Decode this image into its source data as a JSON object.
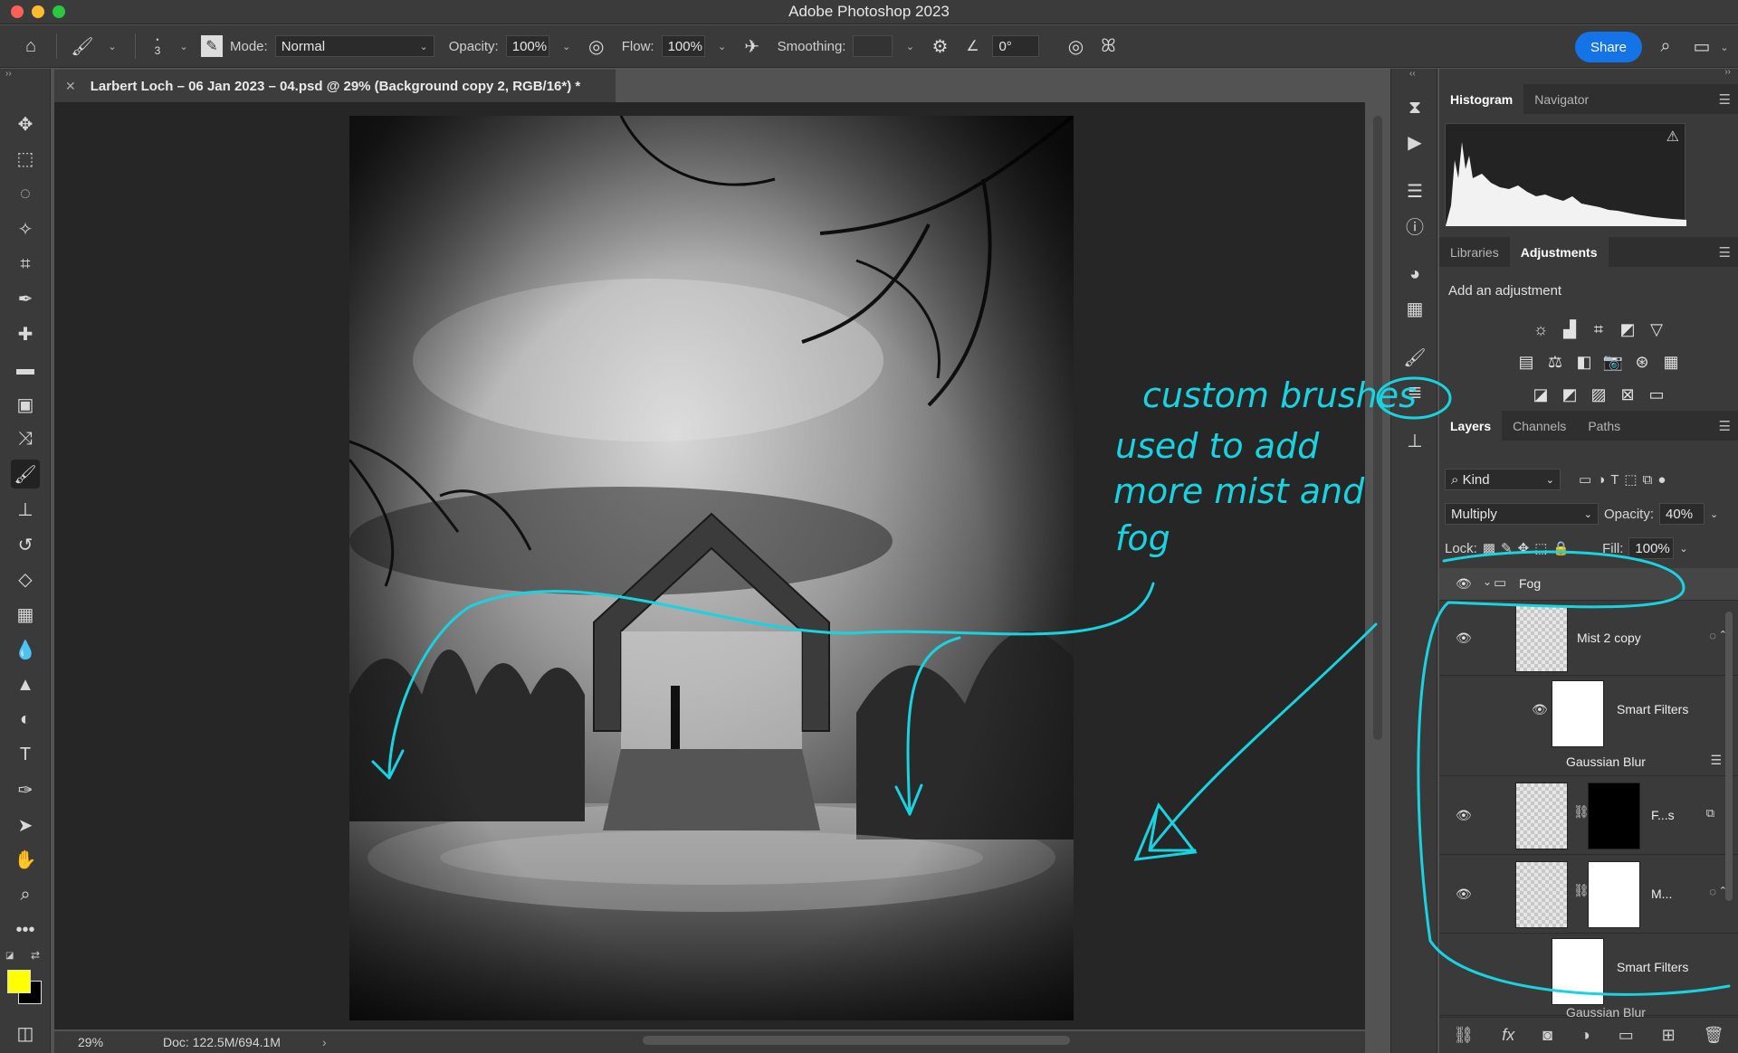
{
  "app": {
    "title": "Adobe Photoshop 2023"
  },
  "options": {
    "brush_size": "3",
    "mode_label": "Mode:",
    "mode_value": "Normal",
    "opacity_label": "Opacity:",
    "opacity_value": "100%",
    "flow_label": "Flow:",
    "flow_value": "100%",
    "smoothing_label": "Smoothing:",
    "angle_value": "0°",
    "share_label": "Share"
  },
  "document": {
    "tab_title": "Larbert Loch – 06 Jan 2023 – 04.psd @ 29% (Background copy 2, RGB/16*) *",
    "zoom": "29%",
    "doc_info": "Doc: 122.5M/694.1M"
  },
  "top_panel": {
    "tabs": [
      "Histogram",
      "Navigator"
    ]
  },
  "adjust_panel": {
    "tabs": [
      "Libraries",
      "Adjustments"
    ],
    "hint": "Add an adjustment"
  },
  "layers_panel": {
    "tabs": [
      "Layers",
      "Channels",
      "Paths"
    ],
    "filter_kind": "Kind",
    "blend_mode": "Multiply",
    "opacity_label": "Opacity:",
    "opacity_value": "40%",
    "lock_label": "Lock:",
    "fill_label": "Fill:",
    "fill_value": "100%",
    "layers": [
      {
        "name": "Fog"
      },
      {
        "name": "Mist 2 copy"
      },
      {
        "name": "Smart Filters"
      },
      {
        "name": "Gaussian Blur"
      },
      {
        "name": "F...s"
      },
      {
        "name": "M..."
      },
      {
        "name": "Smart Filters"
      },
      {
        "name": "Gaussian Blur"
      }
    ]
  },
  "annotation": {
    "lines": [
      "custom brushes",
      "used to add",
      "more mist and",
      "fog"
    ],
    "color": "#19d3e0"
  },
  "colors": {
    "foreground": "#ffff00",
    "background": "#000000",
    "accent": "#1473e6"
  }
}
